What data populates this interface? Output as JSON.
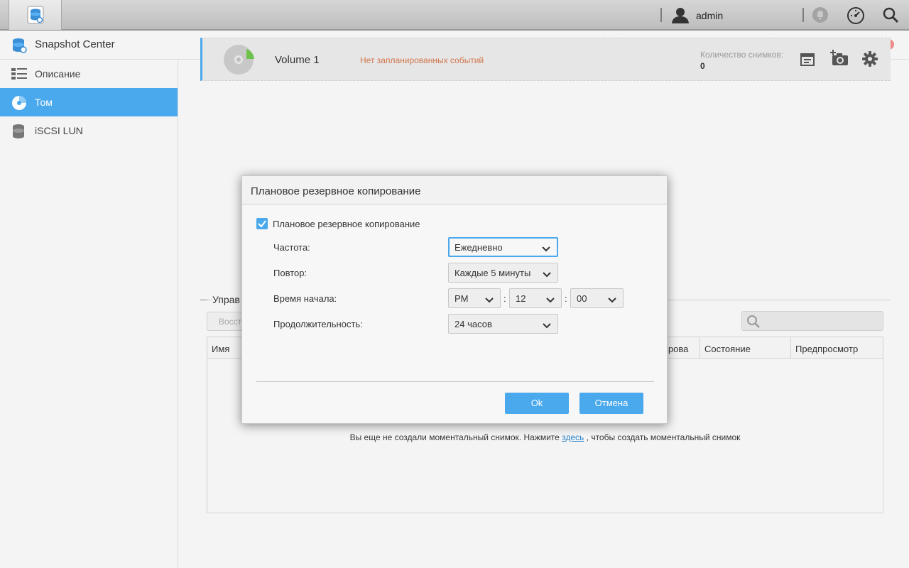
{
  "topbar": {
    "user": "admin"
  },
  "window": {
    "title": "Snapshot Center",
    "controls": [
      "#5bc6c6",
      "#f2c94c",
      "#a5cf4f",
      "#f08a8a"
    ]
  },
  "sidebar": {
    "items": [
      {
        "label": "Описание",
        "icon": "list-icon"
      },
      {
        "label": "Том",
        "icon": "volume-icon",
        "active": true
      },
      {
        "label": "iSCSI LUN",
        "icon": "database-icon"
      }
    ]
  },
  "volume": {
    "name": "Volume 1",
    "status": "Нет запланированных событий",
    "count_label": "Количество снимков:",
    "count": "0"
  },
  "snapshots": {
    "section_title": "Управ",
    "restore_label": "Восст",
    "columns": [
      "Имя",
      "кирова",
      "Состояние",
      "Предпросмотр"
    ],
    "empty_prefix": "Вы еще не создали моментальный снимок. Нажмите ",
    "empty_link": "здесь",
    "empty_suffix": " , чтобы создать моментальный снимок"
  },
  "dialog": {
    "title": "Плановое резервное копирование",
    "checkbox_label": "Плановое резервное копирование",
    "checked": true,
    "frequency_label": "Частота:",
    "frequency_value": "Ежедневно",
    "repeat_label": "Повтор:",
    "repeat_value": "Каждые 5 минуты",
    "start_label": "Время начала:",
    "start_ampm": "PM",
    "start_hour": "12",
    "start_minute": "00",
    "time_sep": ":",
    "duration_label": "Продолжительность:",
    "duration_value": "24 часов",
    "ok_label": "Ok",
    "cancel_label": "Отмена"
  }
}
